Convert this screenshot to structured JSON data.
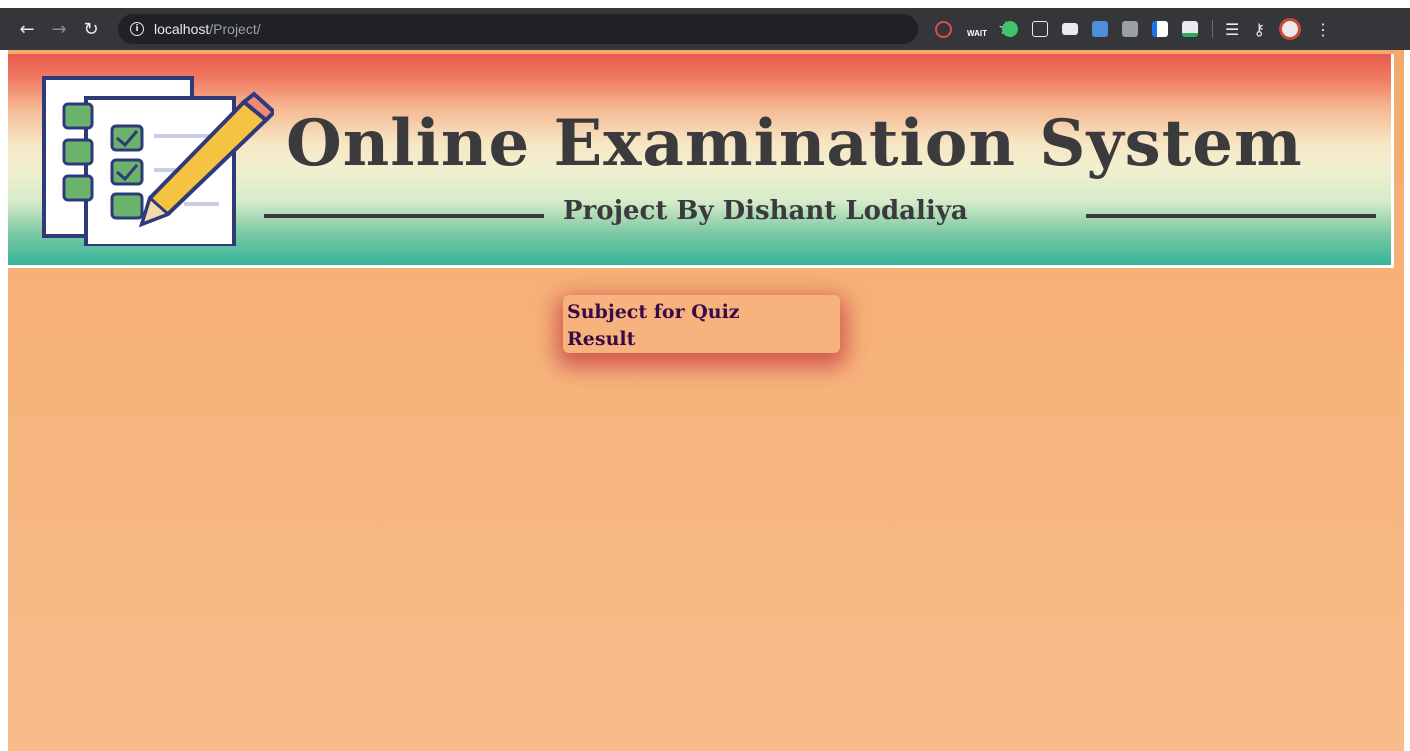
{
  "browser": {
    "url_host": "localhost",
    "url_path": "/Project/",
    "extensions": {
      "wait_label": "WAIT"
    },
    "colors": {
      "toolbar": "#35363a",
      "omnibox": "#202124"
    }
  },
  "banner": {
    "title": "Online Examination System",
    "subtitle": "Project By Dishant Lodaliya"
  },
  "menu": {
    "items": [
      {
        "label": "Subject for Quiz"
      },
      {
        "label": "Result"
      }
    ],
    "colors": {
      "link": "#3a0a48",
      "shadow": "#be283c"
    }
  }
}
